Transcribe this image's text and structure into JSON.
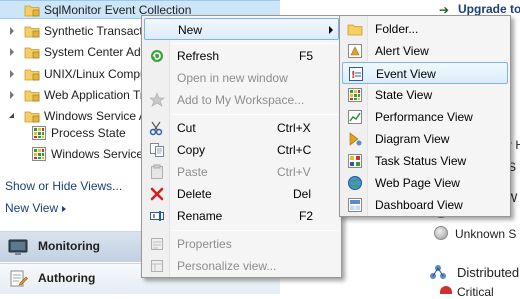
{
  "nav": {
    "tree": [
      {
        "label": "SqlMonitor Event Collection",
        "selected": true
      },
      {
        "label": "Synthetic Transaction"
      },
      {
        "label": "System Center Advis"
      },
      {
        "label": "UNIX/Linux Comput"
      },
      {
        "label": "Web Application Tran"
      },
      {
        "label": "Windows Service An"
      },
      {
        "label": "Process State"
      },
      {
        "label": "Windows Service S"
      }
    ],
    "show_hide_label": "Show or Hide Views...",
    "new_view_label": "New View",
    "wunderbar": [
      {
        "label": "Monitoring"
      },
      {
        "label": "Authoring"
      }
    ]
  },
  "right_pane": {
    "upgrade_text": "Upgrade to",
    "h_fragment": "r H",
    "s_fragment": "S",
    "with_fragment": "W",
    "legend_item_1": "d",
    "legend_item_2": "Unknown S",
    "distributed_label": "Distributed",
    "critical_label": "Critical"
  },
  "context_menu": {
    "items": [
      {
        "label": "New",
        "has_submenu": true
      },
      {
        "label": "Refresh",
        "shortcut": "F5"
      },
      {
        "label": "Open in new window",
        "disabled": true
      },
      {
        "label": "Add to My Workspace...",
        "disabled": true
      },
      {
        "label": "Cut",
        "shortcut": "Ctrl+X"
      },
      {
        "label": "Copy",
        "shortcut": "Ctrl+C"
      },
      {
        "label": "Paste",
        "shortcut": "Ctrl+V",
        "disabled": true
      },
      {
        "label": "Delete",
        "shortcut": "Del"
      },
      {
        "label": "Rename",
        "shortcut": "F2"
      },
      {
        "label": "Properties",
        "disabled": true
      },
      {
        "label": "Personalize view...",
        "disabled": true
      }
    ]
  },
  "submenu": {
    "items": [
      {
        "label": "Folder..."
      },
      {
        "label": "Alert View"
      },
      {
        "label": "Event View",
        "highlighted": true
      },
      {
        "label": "State View"
      },
      {
        "label": "Performance View"
      },
      {
        "label": "Diagram View"
      },
      {
        "label": "Task Status View"
      },
      {
        "label": "Web Page View"
      },
      {
        "label": "Dashboard View"
      }
    ]
  }
}
